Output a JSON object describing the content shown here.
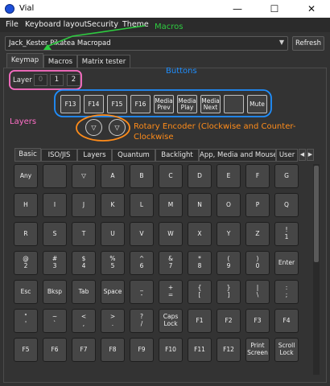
{
  "window": {
    "title": "Vial",
    "minimize": "—",
    "maximize": "☐",
    "close": "✕"
  },
  "menu": [
    "File",
    "Keyboard layout",
    "Security",
    "Theme"
  ],
  "annotations": {
    "macros": "Macros",
    "buttons": "Buttons",
    "layers": "Layers",
    "encoder_line1": "Rotary Encoder (Clockwise and Counter-",
    "encoder_line2": "Clockwise",
    "colors": {
      "macros": "#2ecc40",
      "buttons": "#1f8fff",
      "layers": "#ff6ec7",
      "encoder": "#ff8c1a"
    }
  },
  "device": {
    "selected": "Jack_Kester Pikatea Macropad",
    "refresh_label": "Refresh"
  },
  "top_tabs": [
    "Keymap",
    "Macros",
    "Matrix tester"
  ],
  "layers": {
    "label": "Layer",
    "items": [
      "0",
      "1",
      "2"
    ]
  },
  "keys": [
    "F13",
    "F14",
    "F15",
    "F16",
    "Media\nPrev",
    "Media\nPlay",
    "Media\nNext",
    "",
    "Mute"
  ],
  "encoders": [
    "▽",
    "▽"
  ],
  "keycode_tabs": [
    "Basic",
    "ISO/JIS",
    "Layers",
    "Quantum",
    "Backlight",
    "App, Media and Mouse",
    "User"
  ],
  "tab_scroll": {
    "left": "◀",
    "right": "▶"
  },
  "keycode_grid": [
    [
      "Any",
      "",
      "▽",
      "A",
      "B",
      "C",
      "D",
      "E",
      "F",
      "G"
    ],
    [
      "H",
      "I",
      "J",
      "K",
      "L",
      "M",
      "N",
      "O",
      "P",
      "Q"
    ],
    [
      "R",
      "S",
      "T",
      "U",
      "V",
      "W",
      "X",
      "Y",
      "Z",
      "!\n1"
    ],
    [
      "@\n2",
      "#\n3",
      "$\n4",
      "%\n5",
      "^\n6",
      "&\n7",
      "*\n8",
      "(\n9",
      ")\n0",
      "Enter"
    ],
    [
      "Esc",
      "Bksp",
      "Tab",
      "Space",
      "_\n-",
      "+\n=",
      "{\n[",
      "}\n]",
      "|\n\\",
      ":\n;"
    ],
    [
      "\"\n'",
      "~\n`",
      "<\n,",
      ">\n.",
      "?\n/",
      "Caps\nLock",
      "F1",
      "F2",
      "F3",
      "F4"
    ],
    [
      "F5",
      "F6",
      "F7",
      "F8",
      "F9",
      "F10",
      "F11",
      "F12",
      "Print\nScreen",
      "Scroll\nLock"
    ]
  ]
}
